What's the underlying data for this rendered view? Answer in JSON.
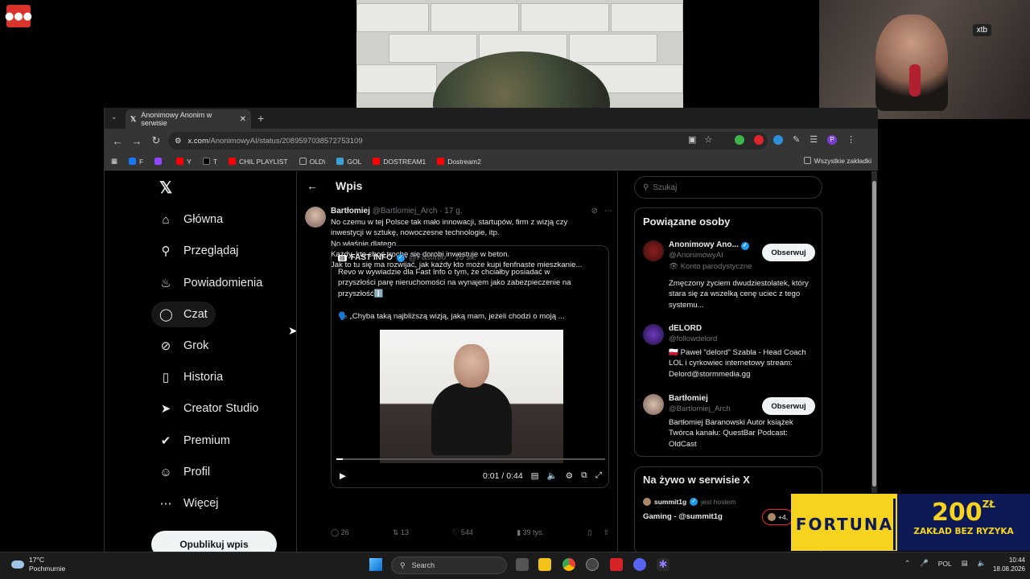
{
  "overlay": {
    "logo_text": "●●●",
    "xtb": "xtb"
  },
  "browser": {
    "tab_title": "Anonimowy Anonim w serwisie",
    "url_domain": "x.com",
    "url_path": "/AnonimowyAI/status/2089597038572753109",
    "bookmarks": [
      {
        "label": "F",
        "color": "#1877f2"
      },
      {
        "label": "",
        "color": "#9146ff"
      },
      {
        "label": "Y",
        "color": "#ff0000"
      },
      {
        "label": "T",
        "color": "#000000"
      },
      {
        "label": "CHIL PLAYLIST",
        "color": "#ff0000"
      },
      {
        "label": "OLD\\",
        "color": "#888888"
      },
      {
        "label": "GOL",
        "color": "#3aa1d4"
      },
      {
        "label": "DOSTREAM1",
        "color": "#ff0000"
      },
      {
        "label": "Dostream2",
        "color": "#ff0000"
      }
    ],
    "all_bookmarks": "Wszystkie zakładki",
    "profile_letter": "P"
  },
  "sidebar": {
    "items": [
      {
        "label": "Główna",
        "icon": "home-icon",
        "glyph": "⌂"
      },
      {
        "label": "Przeglądaj",
        "icon": "search-icon",
        "glyph": "⌕"
      },
      {
        "label": "Powiadomienia",
        "icon": "bell-icon",
        "glyph": "␇"
      },
      {
        "label": "Czat",
        "icon": "chat-icon",
        "glyph": "◯"
      },
      {
        "label": "Grok",
        "icon": "grok-icon",
        "glyph": "⊘"
      },
      {
        "label": "Historia",
        "icon": "bookmark-icon",
        "glyph": "▯"
      },
      {
        "label": "Creator Studio",
        "icon": "rocket-icon",
        "glyph": "➤"
      },
      {
        "label": "Premium",
        "icon": "verified-icon",
        "glyph": "✔"
      },
      {
        "label": "Profil",
        "icon": "profile-icon",
        "glyph": "☺"
      },
      {
        "label": "Więcej",
        "icon": "more-icon",
        "glyph": "⋯"
      }
    ],
    "post_button": "Opublikuj wpis"
  },
  "post": {
    "header_title": "Wpis",
    "author_name": "Bartłomiej",
    "author_handle": "@Bartlomiej_Arch",
    "time": "· 17 g.",
    "text_lines": [
      "No czemu w tej Polsce tak mało innowacji, startupów, firm z wizją czy",
      "inwestycji w sztukę, nowoczesne technologie, itp.",
      "No właśnie dlatego.",
      "Każdy, kto choć trochę się dorobi inwestuje w beton.",
      "Jak to tu się ma rozwijać, jak każdy kto może kupi fenfnaste mieszkanie..."
    ],
    "quote": {
      "author_name": "FAST INFO",
      "author_handle": "@FastInfo",
      "time": "· 16 sie",
      "text_lines": [
        "Revo w wywiadzie dla Fast Info o tym, że chciałby posiadać w",
        "przyszłości parę nieruchomości na wynajem jako zabezpieczenie na",
        "przyszłośćℹ️"
      ],
      "excerpt": "🗣️ „Chyba taką najbliższą wizją, jaką mam, jeżeli chodzi o moją ...",
      "video_time": "0:01 / 0:44",
      "video_progress": 0.023
    },
    "stats": {
      "replies": "26",
      "reposts": "13",
      "likes": "544",
      "views": "39 tys."
    }
  },
  "right": {
    "search_placeholder": "Szukaj",
    "related_title": "Powiązane osoby",
    "people": [
      {
        "name": "Anonimowy Ano...",
        "handle": "@AnonimowyAI",
        "label": "👁 Konto parodystyczne",
        "bio": "Zmęczony życiem dwudziestolatek, który stara się za wszelką cenę uciec z tego systemu...",
        "follow": "Obserwuj"
      },
      {
        "name": "dELORD",
        "handle": "@followdelord",
        "bio": "🇵🇱 Paweł \"delord\" Szabla - Head Coach LOL i cyrkowiec internetowy stream: Delord@stormmedia.gg"
      },
      {
        "name": "Bartłomiej",
        "handle": "@Bartlomiej_Arch",
        "bio": "Bartłomiej Baranowski Autor książek Twórca kanału: QuestBar Podcast: OldCast",
        "follow": "Obserwuj"
      }
    ],
    "live_title": "Na żywo w serwisie X",
    "live_host": "summit1g",
    "live_host_label": "jest hostem",
    "live_name": "Gaming - @summit1g",
    "live_count": "+4,"
  },
  "ad": {
    "brand": "FORTUNA",
    "amount": "200",
    "currency": "ZŁ",
    "sub": "ZAKŁAD BEZ RYZYKA"
  },
  "taskbar": {
    "temp": "17°C",
    "weather": "Pochmurnie",
    "search": "Search",
    "lang": "POL",
    "time": "10:44",
    "date": "18.08.2026"
  }
}
